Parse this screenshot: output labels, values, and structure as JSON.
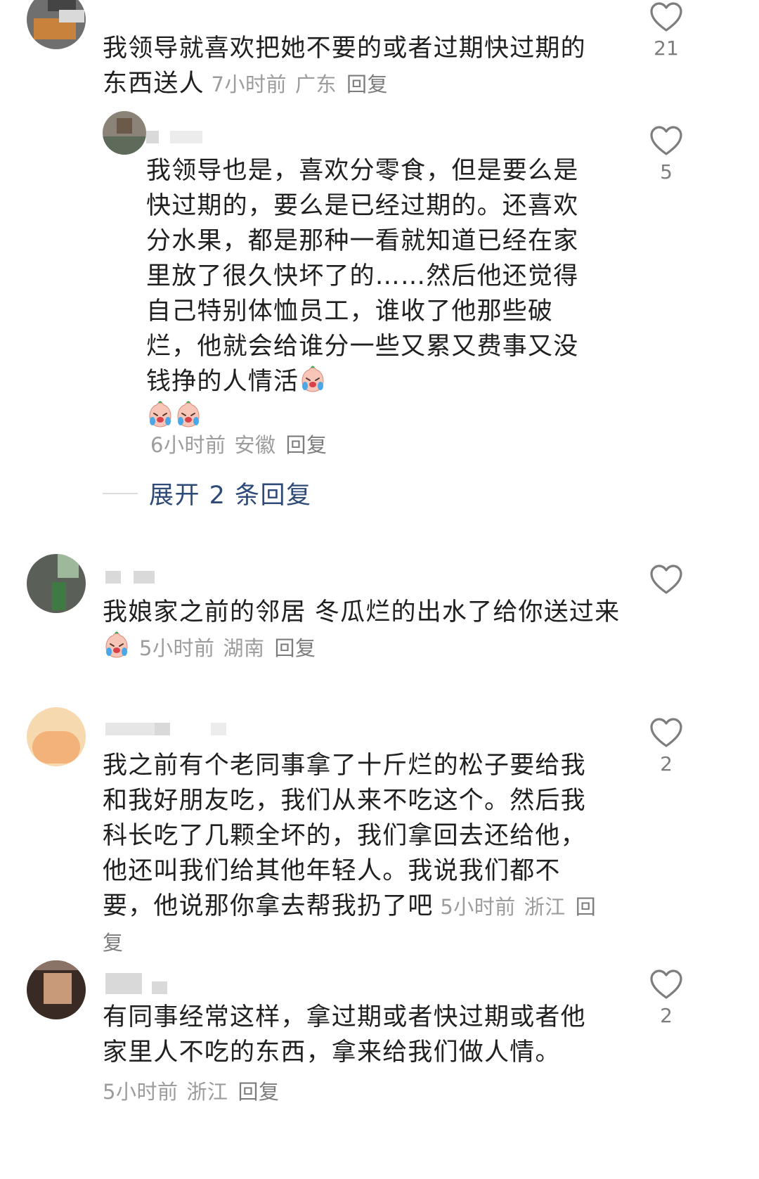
{
  "comments": [
    {
      "text": "我领导就喜欢把她不要的或者过期快过期的东西送人",
      "time": "7小时前",
      "location": "广东",
      "reply_label": "回复",
      "likes": "21"
    },
    {
      "text": "我领导也是，喜欢分零食，但是要么是快过期的，要么是已经过期的。还喜欢分水果，都是那种一看就知道已经在家里放了很久快坏了的……然后他还觉得自己特别体恤员工，谁收了他那些破烂，他就会给谁分一些又累又费事又没钱挣的人情活",
      "time": "6小时前",
      "location": "安徽",
      "reply_label": "回复",
      "likes": "5",
      "expand_label": "展开 2 条回复"
    },
    {
      "text": "我娘家之前的邻居 冬瓜烂的出水了给你送过来",
      "time": "5小时前",
      "location": "湖南",
      "reply_label": "回复",
      "likes": ""
    },
    {
      "text": "我之前有个老同事拿了十斤烂的松子要给我和我好朋友吃，我们从来不吃这个。然后我科长吃了几颗全坏的，我们拿回去还给他，他还叫我们给其他年轻人。我说我们都不要，他说那你拿去帮我扔了吧",
      "time": "5小时前",
      "location": "浙江",
      "reply_label": "回复",
      "likes": "2"
    },
    {
      "text": "有同事经常这样，拿过期或者快过期或者他家里人不吃的东西，拿来给我们做人情。",
      "time": "5小时前",
      "location": "浙江",
      "reply_label": "回复",
      "likes": "2"
    }
  ],
  "icons": {
    "like": "heart-outline-icon",
    "emoji": "crying-face-emoji"
  },
  "colors": {
    "text": "#202020",
    "meta": "#9c9c9c",
    "link": "#2d4a78",
    "icon": "#7d7d7d"
  }
}
